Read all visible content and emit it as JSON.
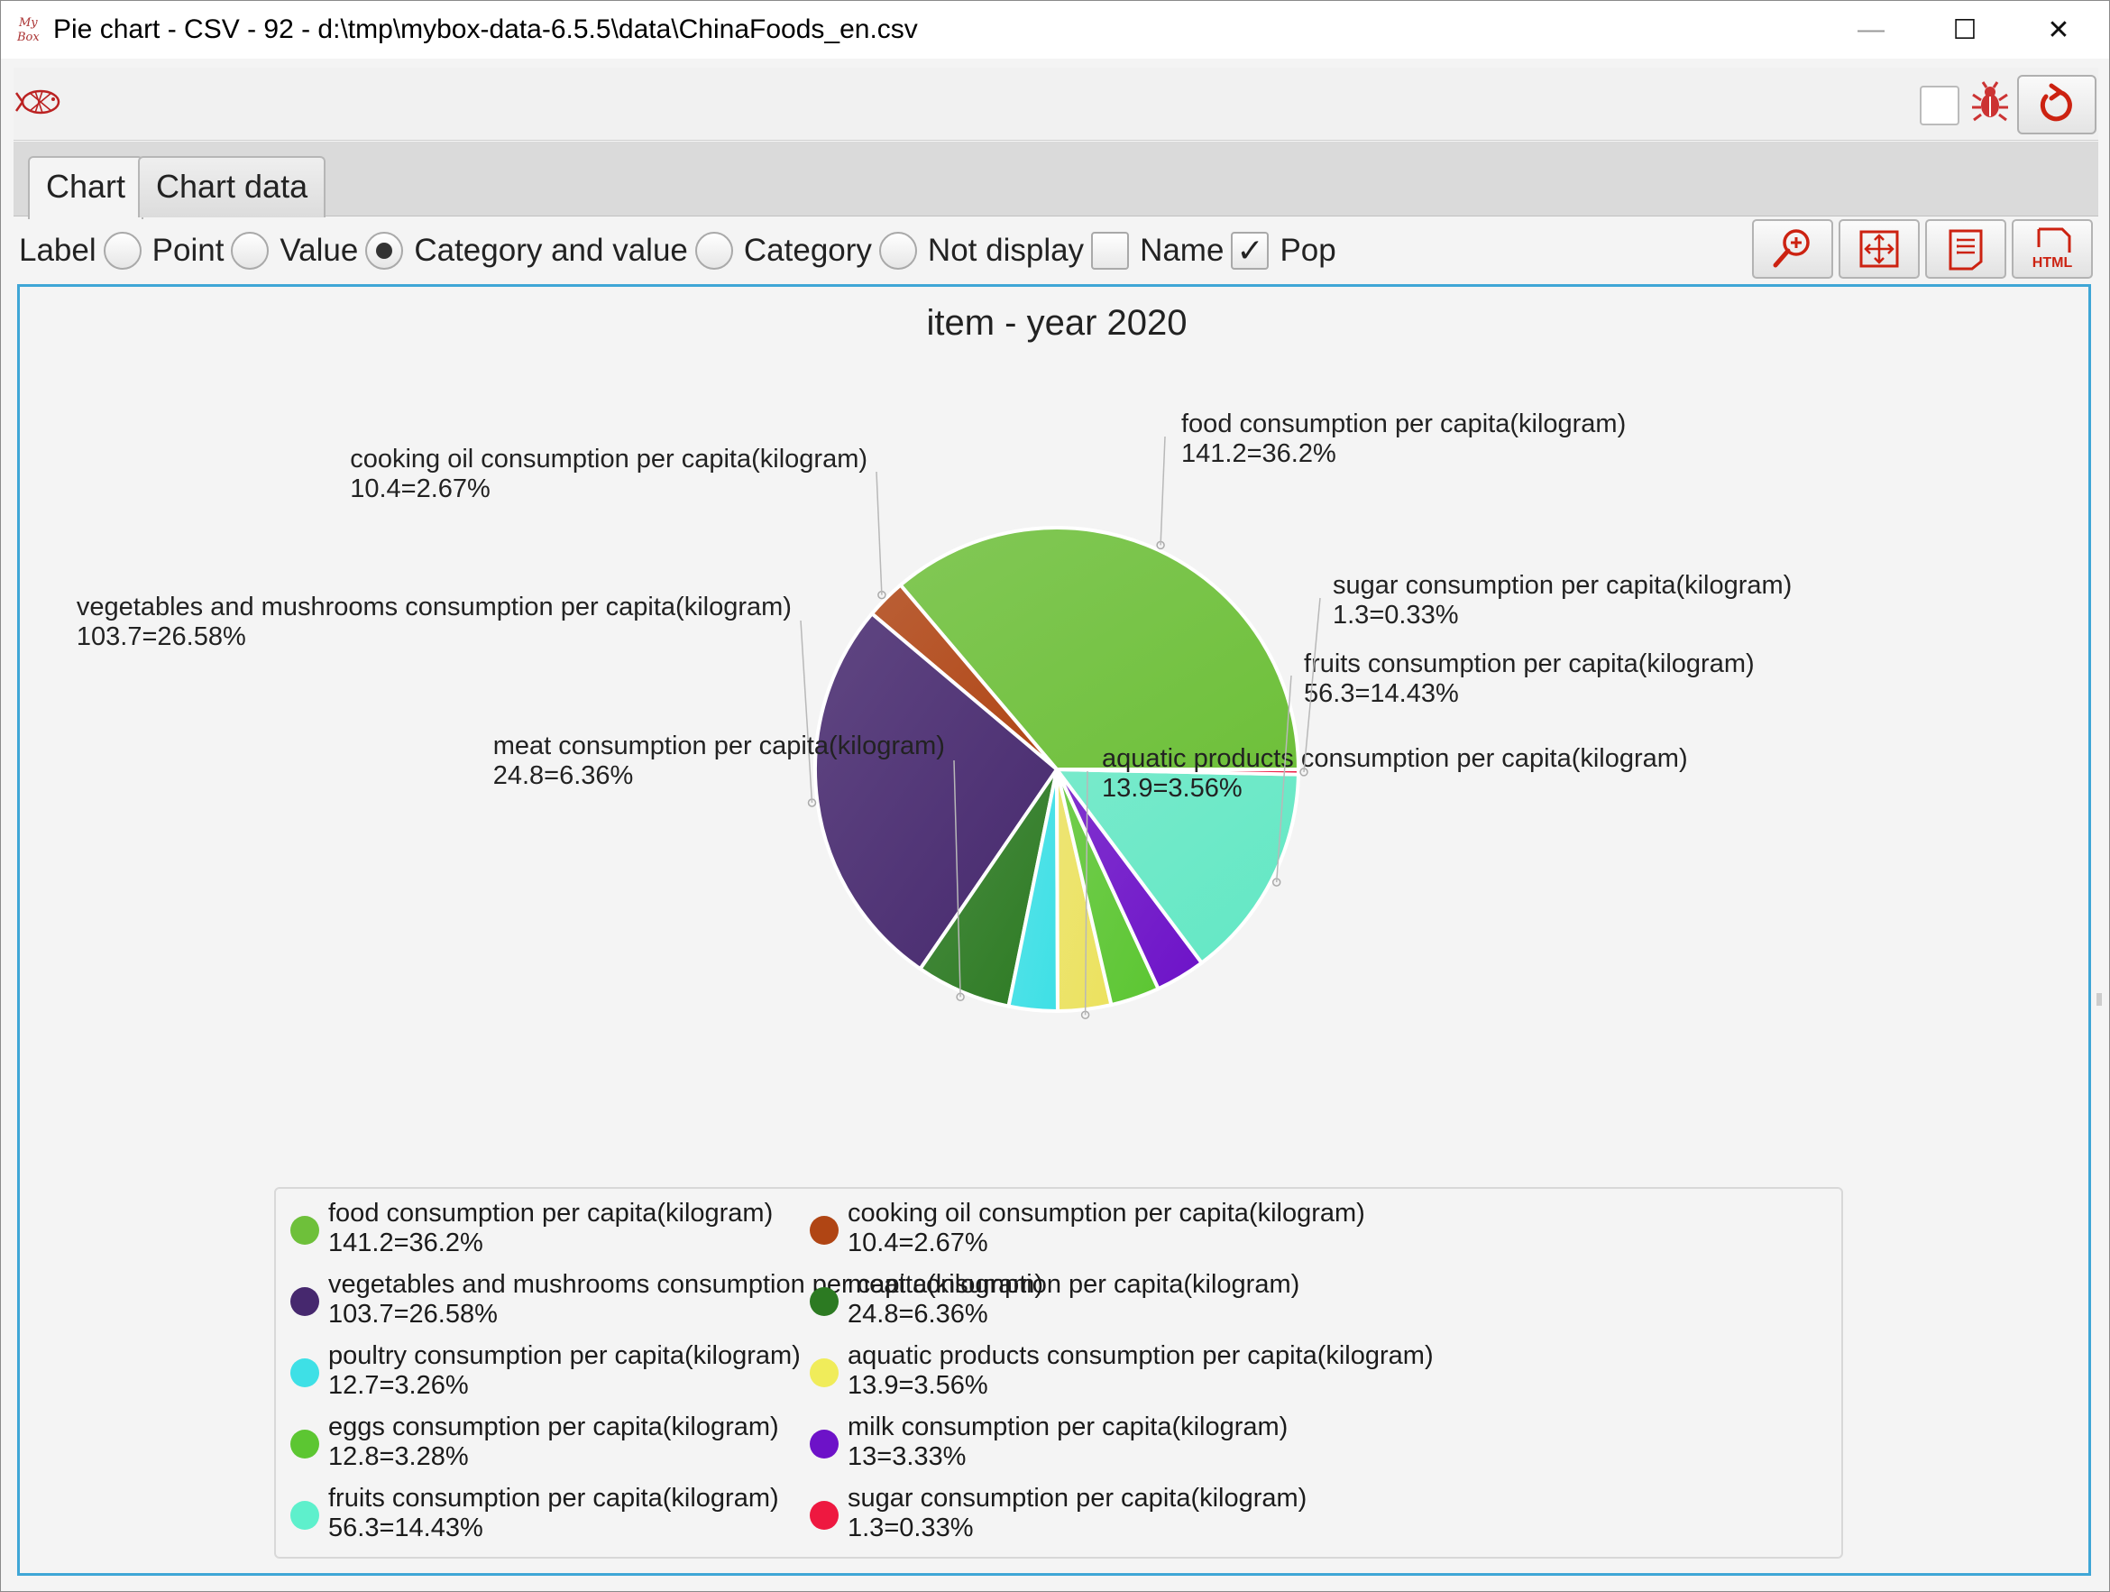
{
  "window": {
    "title": "Pie chart - CSV - 92 - d:\\tmp\\mybox-data-6.5.5\\data\\ChinaFoods_en.csv",
    "app_logo_text": "MyBox",
    "controls": {
      "minimize": "—",
      "maximize": "☐",
      "close": "✕"
    }
  },
  "toolbar": {
    "icons": [
      "fish-logo-icon",
      "bug-icon",
      "refresh-icon"
    ]
  },
  "tabs": [
    {
      "label": "Chart",
      "active": true
    },
    {
      "label": "Chart data",
      "active": false
    }
  ],
  "options": {
    "label_prefix": "Label",
    "radios": [
      {
        "label": "Point",
        "selected": false
      },
      {
        "label": "Value",
        "selected": false
      },
      {
        "label": "Category and value",
        "selected": true
      },
      {
        "label": "Category",
        "selected": false
      },
      {
        "label": "Not display",
        "selected": false
      }
    ],
    "checkboxes": [
      {
        "label": "Name",
        "checked": false
      },
      {
        "label": "Pop",
        "checked": true
      }
    ],
    "buttons": [
      "zoom-icon",
      "fit-screen-icon",
      "data-sheet-icon",
      "html-export-icon"
    ]
  },
  "chart_data": {
    "type": "pie",
    "title": "item - year 2020",
    "start_angle_deg": 0,
    "direction": "counterclockwise",
    "slices": [
      {
        "name": "food consumption per capita(kilogram)",
        "value": 141.2,
        "percent": "36.2%",
        "label": "141.2=36.2%",
        "color": "#6ec03a"
      },
      {
        "name": "cooking oil consumption per capita(kilogram)",
        "value": 10.4,
        "percent": "2.67%",
        "label": "10.4=2.67%",
        "color": "#b04514"
      },
      {
        "name": "vegetables and mushrooms consumption per capita(kilogram)",
        "value": 103.7,
        "percent": "26.58%",
        "label": "103.7=26.58%",
        "color": "#46286e"
      },
      {
        "name": "meat consumption per capita(kilogram)",
        "value": 24.8,
        "percent": "6.36%",
        "label": "24.8=6.36%",
        "color": "#2c7a22"
      },
      {
        "name": "poultry consumption per capita(kilogram)",
        "value": 12.7,
        "percent": "3.26%",
        "label": "12.7=3.26%",
        "color": "#3ee0e6"
      },
      {
        "name": "aquatic products consumption per capita(kilogram)",
        "value": 13.9,
        "percent": "3.56%",
        "label": "13.9=3.56%",
        "color": "#ece25e"
      },
      {
        "name": "eggs consumption per capita(kilogram)",
        "value": 12.8,
        "percent": "3.28%",
        "label": "12.8=3.28%",
        "color": "#5cc632"
      },
      {
        "name": "milk consumption per capita(kilogram)",
        "value": 13,
        "percent": "3.33%",
        "label": "13=3.33%",
        "color": "#6d12c8"
      },
      {
        "name": "fruits consumption per capita(kilogram)",
        "value": 56.3,
        "percent": "14.43%",
        "label": "56.3=14.43%",
        "color": "#62e8c4"
      },
      {
        "name": "sugar consumption per capita(kilogram)",
        "value": 1.3,
        "percent": "0.33%",
        "label": "1.3=0.33%",
        "color": "#ee1840"
      }
    ],
    "labeled_slices": [
      0,
      1,
      2,
      3,
      5,
      8,
      9
    ],
    "legend": {
      "placement": "bottom",
      "items": [
        {
          "name": "food consumption per capita(kilogram)",
          "value": "141.2=36.2%",
          "color": "#6ec03a"
        },
        {
          "name": "cooking oil consumption per capita(kilogram)",
          "value": "10.4=2.67%",
          "color": "#b04514"
        },
        {
          "name": "vegetables and mushrooms consumption per capita(kilogram)",
          "value": "103.7=26.58%",
          "color": "#46286e"
        },
        {
          "name": "meat consumption per capita(kilogram)",
          "value": "24.8=6.36%",
          "color": "#2c7a22"
        },
        {
          "name": "poultry consumption per capita(kilogram)",
          "value": "12.7=3.26%",
          "color": "#3ee0e6"
        },
        {
          "name": "aquatic products consumption per capita(kilogram)",
          "value": "13.9=3.56%",
          "color": "#f0ec5a"
        },
        {
          "name": "eggs consumption per capita(kilogram)",
          "value": "12.8=3.28%",
          "color": "#5cc632"
        },
        {
          "name": "milk consumption per capita(kilogram)",
          "value": "13=3.33%",
          "color": "#6d12c8"
        },
        {
          "name": "fruits consumption per capita(kilogram)",
          "value": "56.3=14.43%",
          "color": "#5ef0cc"
        },
        {
          "name": "sugar consumption per capita(kilogram)",
          "value": "1.3=0.33%",
          "color": "#ee1840"
        }
      ]
    }
  }
}
